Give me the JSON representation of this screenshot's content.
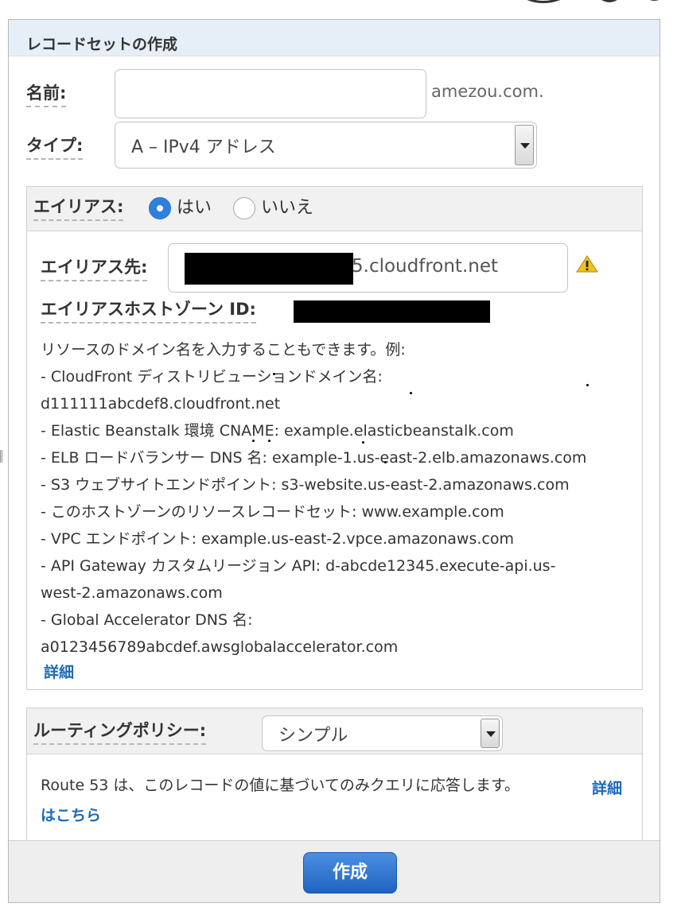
{
  "panel": {
    "title": "レコードセットの作成"
  },
  "name_field": {
    "label": "名前:",
    "value": "",
    "suffix": "amezou.com."
  },
  "type_field": {
    "label": "タイプ:",
    "selected": "A – IPv4 アドレス"
  },
  "alias": {
    "label": "エイリアス:",
    "options": [
      {
        "label": "はい",
        "checked": true
      },
      {
        "label": "いいえ",
        "checked": false
      }
    ],
    "target_label": "エイリアス先:",
    "target_value": "5.cloudfront.net",
    "hosted_zone_label": "エイリアスホストゾーン ID:",
    "help_lines": [
      "リソースのドメイン名を入力することもできます。例:",
      "- CloudFront ディストリビューションドメイン名:",
      "d111111abcdef8.cloudfront.net",
      "- Elastic Beanstalk 環境 CNAME: example.elasticbeanstalk.com",
      "- ELB ロードバランサー DNS 名: example-1.us-east-2.elb.amazonaws.com",
      "- S3 ウェブサイトエンドポイント: s3-website.us-east-2.amazonaws.com",
      "- このホストゾーンのリソースレコードセット: www.example.com",
      "- VPC エンドポイント: example.us-east-2.vpce.amazonaws.com",
      "- API Gateway カスタムリージョン API: d-abcde12345.execute-api.us-",
      "west-2.amazonaws.com",
      "- Global Accelerator DNS 名:",
      "a0123456789abcdef.awsglobalaccelerator.com"
    ],
    "details_link": "詳細",
    "warning_icon": "warning-icon"
  },
  "routing": {
    "label": "ルーティングポリシー:",
    "selected": "シンプル",
    "description": "Route 53 は、このレコードの値に基づいてのみクエリに応答します。",
    "link_line1": "詳細",
    "link_line2": "はこちら"
  },
  "footer": {
    "create_label": "作成"
  },
  "colors": {
    "accent": "#2f7fdf",
    "link": "#1d6ab8",
    "header_bg": "#e6eef8",
    "warning": "#f2c21b"
  }
}
